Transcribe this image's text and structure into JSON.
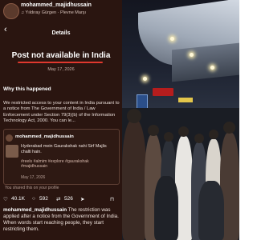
{
  "left_panel": {
    "top_user": "mohammed_majidhussain",
    "music": "♫ Yıldıray Gürgen · Plevne Marşı",
    "back_icon": "chevron-left-icon",
    "header_title": "Details",
    "status_title": "Post not available in India",
    "status_date": "May 17, 2026",
    "why_heading": "Why this happened",
    "reason_text": "We restricted access to your content in India pursuant to a notice from The Government of India / Law Enforcement under Section 79(3)(b) of the Information Technology Act, 2000. You can le...",
    "post": {
      "username": "mohammed_majidhussain",
      "caption": "Hyderabad mein Gaurakshak nahi Sirf Majlis chalti hain.",
      "tags": "#reels #almim #explore #gaurakshak #majidhussain",
      "date": "May 17, 2026"
    },
    "shared_note": "You shared this on your profile",
    "stats": {
      "likes": "40.1K",
      "comments": "592",
      "shares": "526"
    },
    "caption_user": "mohammed_majidhussain",
    "caption_text": " The restriction was applied after a notice from the Government of India. When words start reaching people, they start restricting them."
  }
}
